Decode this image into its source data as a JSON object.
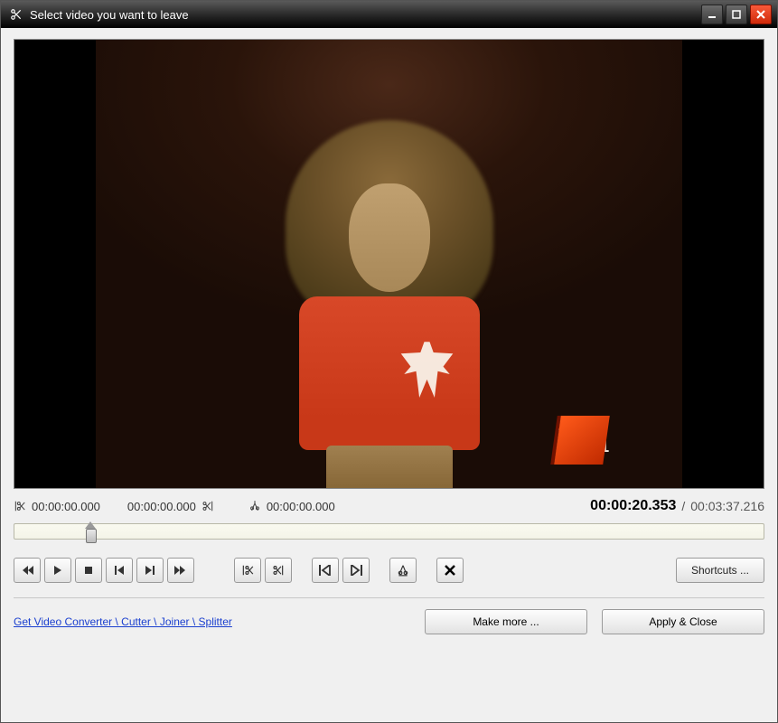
{
  "window": {
    "title": "Select video you want to leave"
  },
  "timeline": {
    "mark_in": "00:00:00.000",
    "mark_out": "00:00:00.000",
    "split_point": "00:00:00.000",
    "current": "00:00:20.353",
    "duration": "00:03:37.216",
    "position_percent": 9.4
  },
  "watermark": {
    "text": "Vh1"
  },
  "buttons": {
    "shortcuts": "Shortcuts ...",
    "make_more": "Make more ...",
    "apply_close": "Apply & Close"
  },
  "link": {
    "text": "Get Video Converter \\ Cutter \\ Joiner \\ Splitter"
  },
  "icons": {
    "prev": "prev",
    "play": "play",
    "stop": "stop",
    "step_back": "step-back",
    "step_fwd": "step-fwd",
    "next": "next",
    "mark_in": "mark-in",
    "mark_out": "mark-out",
    "goto_in": "goto-in",
    "goto_out": "goto-out",
    "split": "split",
    "delete": "delete"
  }
}
